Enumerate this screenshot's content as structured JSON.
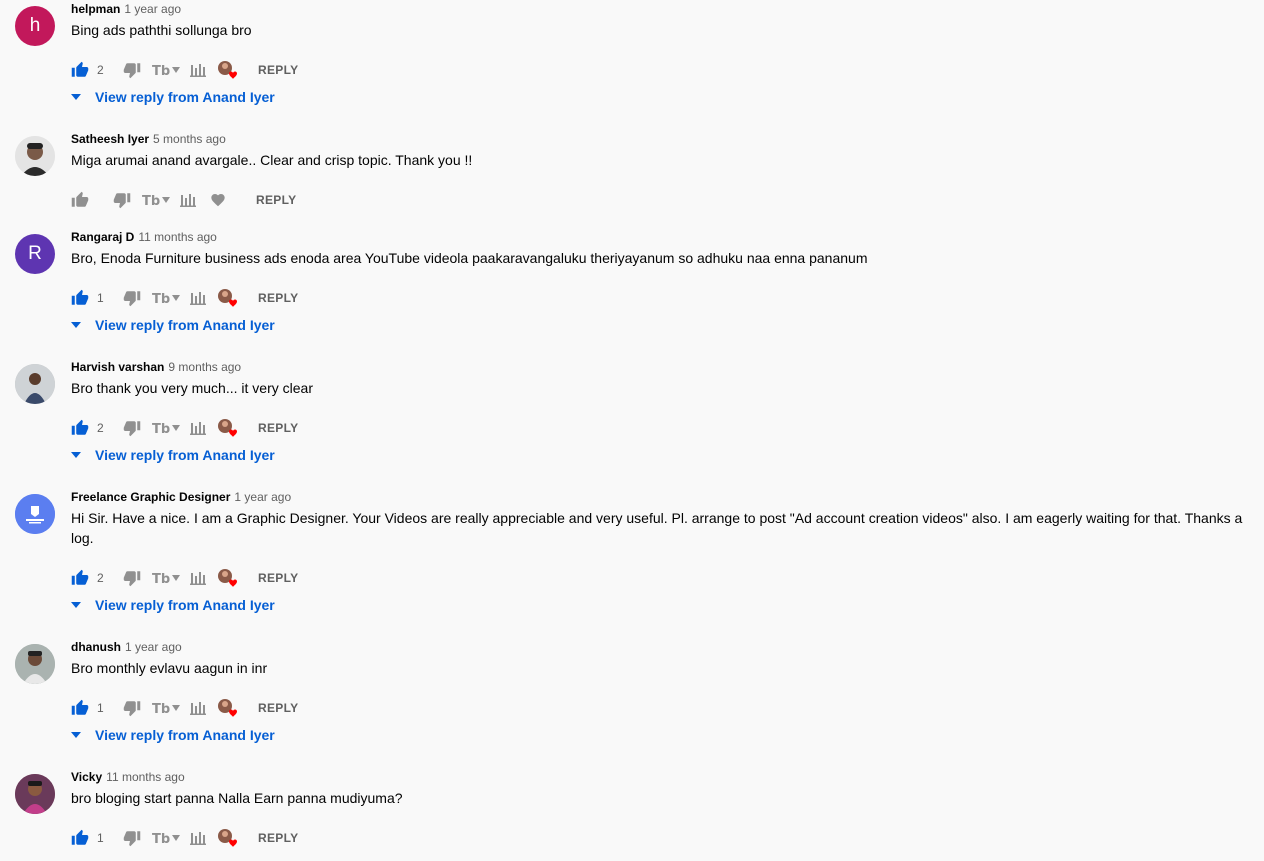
{
  "colors": {
    "background": "#f9f9f9",
    "link": "#065fd4",
    "meta": "#606060",
    "heart": "#ff0000"
  },
  "reply_label": "REPLY",
  "icons": [
    "like-icon",
    "dislike-icon",
    "translate-icon",
    "stats-icon",
    "creator-heart-icon",
    "caret-down-icon"
  ],
  "comments": [
    {
      "author": "helpman",
      "time": "1 year ago",
      "text": "Bing ads paththi sollunga bro",
      "likes": "2",
      "liked": true,
      "hearted": true,
      "view_replies": "View reply from Anand Iyer",
      "avatar": {
        "letter": "h",
        "color": "#c2185b"
      }
    },
    {
      "author": "Satheesh Iyer",
      "time": "5 months ago",
      "text": "Miga arumai anand avargale.. Clear and crisp topic. Thank you !!",
      "likes": "",
      "liked": false,
      "hearted": false,
      "view_replies": "",
      "avatar": {
        "letter": "",
        "color": "#e8e8e8"
      }
    },
    {
      "author": "Rangaraj D",
      "time": "11 months ago",
      "text": "Bro, Enoda Furniture business ads enoda area YouTube videola paakaravangaluku theriyayanum so adhuku naa enna pananum",
      "likes": "1",
      "liked": true,
      "hearted": true,
      "view_replies": "View reply from Anand Iyer",
      "avatar": {
        "letter": "R",
        "color": "#5e35b1"
      }
    },
    {
      "author": "Harvish varshan",
      "time": "9 months ago",
      "text": "Bro thank you very much... it very clear",
      "likes": "2",
      "liked": true,
      "hearted": true,
      "view_replies": "View reply from Anand Iyer",
      "avatar": {
        "letter": "",
        "color": "#b9b9b9"
      }
    },
    {
      "author": "Freelance Graphic Designer",
      "time": "1 year ago",
      "text": "Hi Sir. Have a nice. I am a Graphic Designer. Your Videos are really appreciable and very useful. Pl. arrange to post \"Ad account creation videos\" also. I am eagerly waiting for that. Thanks a log.",
      "likes": "2",
      "liked": true,
      "hearted": true,
      "view_replies": "View reply from Anand Iyer",
      "avatar": {
        "letter": "",
        "color": "#5b7ef0"
      }
    },
    {
      "author": "dhanush",
      "time": "1 year ago",
      "text": "Bro monthly evlavu aagun in inr",
      "likes": "1",
      "liked": true,
      "hearted": true,
      "view_replies": "View reply from Anand Iyer",
      "avatar": {
        "letter": "",
        "color": "#9aa5a0"
      }
    },
    {
      "author": "Vicky",
      "time": "11 months ago",
      "text": "bro bloging start panna Nalla Earn panna mudiyuma?",
      "likes": "1",
      "liked": true,
      "hearted": true,
      "view_replies": "",
      "avatar": {
        "letter": "",
        "color": "#8b4c6a"
      }
    }
  ]
}
